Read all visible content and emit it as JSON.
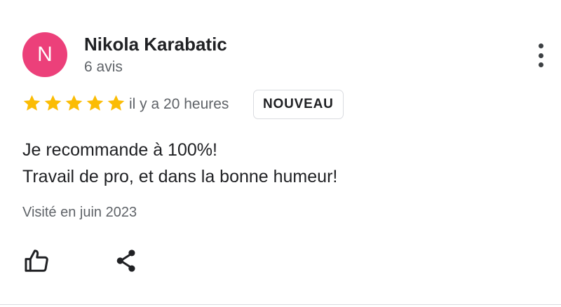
{
  "reviewer": {
    "initial": "N",
    "avatar_color": "#ec407a",
    "name": "Nikola Karabatic",
    "review_count": "6 avis"
  },
  "review": {
    "rating": 5,
    "rating_max": 5,
    "star_color": "#fbbc04",
    "time": "il y a 20 heures",
    "badge": "NOUVEAU",
    "text_lines": [
      "Je recommande à 100%!",
      "Travail de pro, et dans la bonne humeur!"
    ],
    "visited": "Visité en juin 2023"
  },
  "actions": {
    "more_icon": "more-vert-icon",
    "like_icon": "thumb-up-icon",
    "share_icon": "share-icon"
  }
}
